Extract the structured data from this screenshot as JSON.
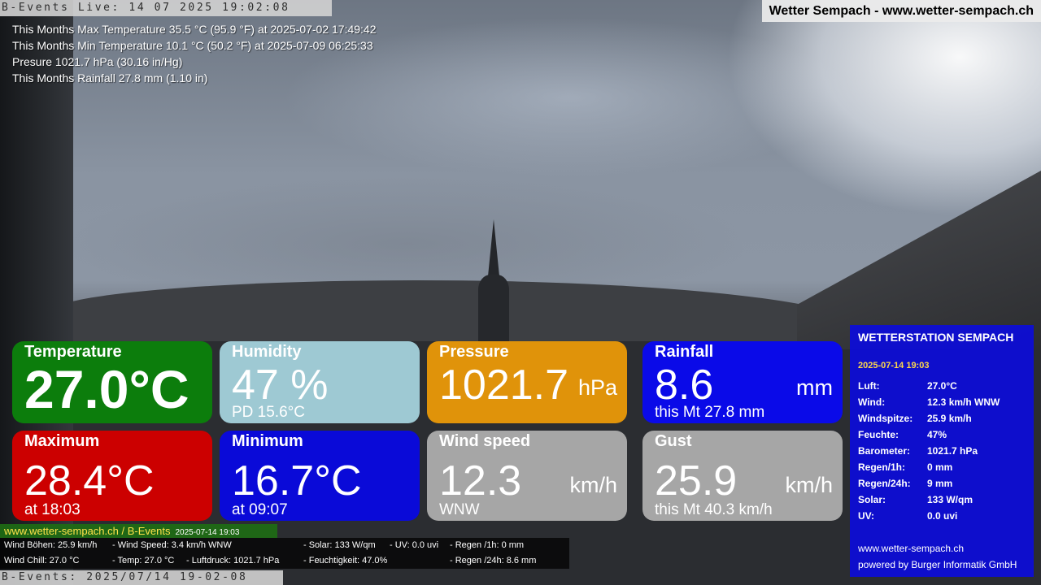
{
  "live_bar": "B-Events Live: 14 07 2025 19:02:08",
  "bottom_bar": "B-Events: 2025/07/14 19-02-08",
  "site_title": "Wetter Sempach - www.wetter-sempach.ch",
  "stats": [
    "This Months Max Temperature 35.5 °C (95.9 °F) at 2025-07-02 17:49:42",
    "This Months Min Temperature 10.1 °C (50.2 °F) at 2025-07-09 06:25:33",
    "Presure 1021.7 hPa (30.16 in/Hg)",
    "This Months Rainfall 27.8 mm (1.10 in)"
  ],
  "tiles": {
    "temperature": {
      "label": "Temperature",
      "value": "27.0°C",
      "color": "#0c7d0c"
    },
    "humidity": {
      "label": "Humidity",
      "value": "47 %",
      "sub": "PD 15.6°C",
      "color": "#9ec9d3"
    },
    "pressure": {
      "label": "Pressure",
      "value": "1021.7",
      "unit": "hPa",
      "color": "#e0930a"
    },
    "rainfall": {
      "label": "Rainfall",
      "value": "8.6",
      "unit": "mm",
      "sub": "this Mt 27.8 mm",
      "color": "#0a0ae8"
    },
    "maximum": {
      "label": "Maximum",
      "value": "28.4°C",
      "sub": "at 18:03",
      "color": "#cc0000"
    },
    "minimum": {
      "label": "Minimum",
      "value": "16.7°C",
      "sub": "at 09:07",
      "color": "#0a0ad8"
    },
    "wind": {
      "label": "Wind speed",
      "value": "12.3",
      "unit": "km/h",
      "sub": "WNW",
      "color": "#a6a6a6"
    },
    "gust": {
      "label": "Gust",
      "value": "25.9",
      "unit": "km/h",
      "sub": "this Mt 40.3 km/h",
      "color": "#a6a6a6"
    }
  },
  "panel": {
    "title": "WETTERSTATION SEMPACH",
    "date": "2025-07-14 19:03",
    "rows": [
      {
        "k": "Luft:",
        "v": "27.0°C"
      },
      {
        "k": "Wind:",
        "v": "12.3 km/h  WNW"
      },
      {
        "k": "Windspitze:",
        "v": "25.9 km/h"
      },
      {
        "k": "Feuchte:",
        "v": "47%"
      },
      {
        "k": "Barometer:",
        "v": "1021.7 hPa"
      },
      {
        "k": "Regen/1h:",
        "v": "0 mm"
      },
      {
        "k": "Regen/24h:",
        "v": "9 mm"
      },
      {
        "k": "Solar:",
        "v": "133 W/qm"
      },
      {
        "k": "UV:",
        "v": "0.0 uvi"
      }
    ],
    "footer1": "www.wetter-sempach.ch",
    "footer2": "powered by Burger Informatik GmbH"
  },
  "strip": {
    "title": "www.wetter-sempach.ch / B-Events",
    "date": "2025-07-14 19:03",
    "line1": {
      "a": "Wind Böhen: 25.9 km/h",
      "b": "- Wind Speed: 3.4 km/h WNW",
      "c": "- Solar: 133 W/qm",
      "d": "- UV: 0.0 uvi",
      "e": "- Regen /1h:   0 mm"
    },
    "line2": {
      "a": "Wind Chill: 27.0 °C",
      "b": "- Temp: 27.0 °C",
      "c": "- Luftdruck: 1021.7 hPa",
      "d": "- Feuchtigkeit: 47.0%",
      "e": "- Regen /24h: 8.6 mm"
    }
  }
}
